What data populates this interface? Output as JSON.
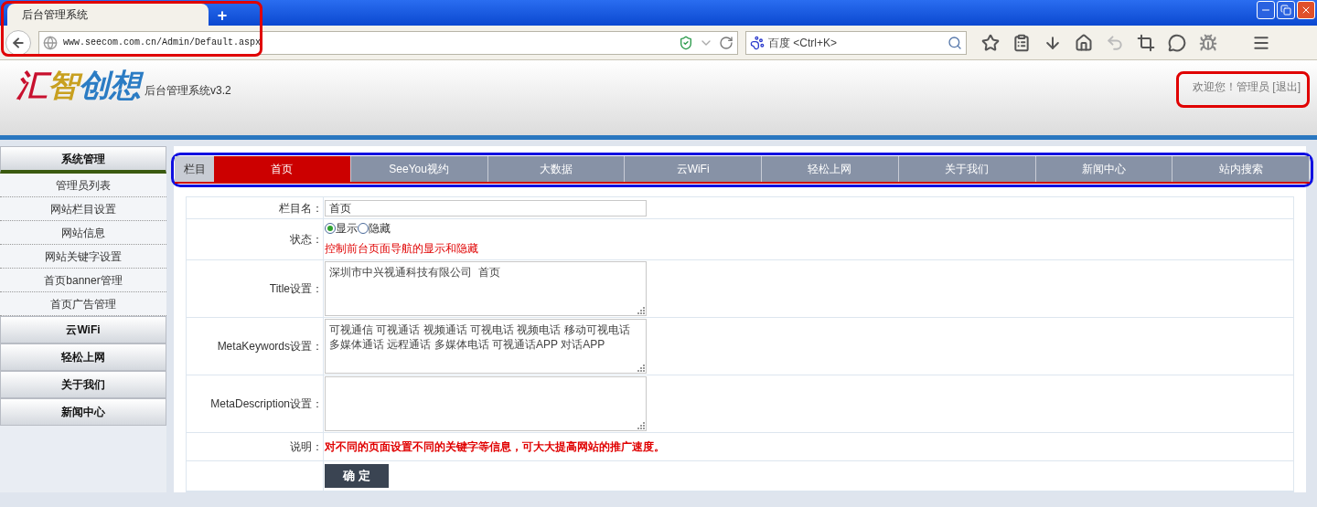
{
  "browser": {
    "tab_title": "后台管理系统",
    "new_tab": "+",
    "url": "www.seecom.com.cn/Admin/Default.aspx",
    "search_placeholder": "百度 <Ctrl+K>"
  },
  "header": {
    "logo": "汇智创想",
    "subtitle": "后台管理系统v3.2",
    "welcome": "欢迎您！管理员",
    "logout": "[退出]"
  },
  "sidebar": {
    "groups": [
      {
        "title": "系统管理",
        "expanded": true,
        "items": [
          "管理员列表",
          "网站栏目设置",
          "网站信息",
          "网站关键字设置",
          "首页banner管理",
          "首页广告管理"
        ]
      },
      {
        "title": "云WiFi",
        "expanded": false
      },
      {
        "title": "轻松上网",
        "expanded": false
      },
      {
        "title": "关于我们",
        "expanded": false
      },
      {
        "title": "新闻中心",
        "expanded": false
      }
    ]
  },
  "nav": {
    "label": "栏目",
    "tabs": [
      {
        "label": "首页",
        "selected": true
      },
      {
        "label": "SeeYou视约",
        "selected": false
      },
      {
        "label": "大数据",
        "selected": false
      },
      {
        "label": "云WiFi",
        "selected": false
      },
      {
        "label": "轻松上网",
        "selected": false
      },
      {
        "label": "关于我们",
        "selected": false
      },
      {
        "label": "新闻中心",
        "selected": false
      },
      {
        "label": "站内搜索",
        "selected": false
      }
    ]
  },
  "form": {
    "rows": [
      {
        "kind": "text",
        "label": "栏目名：",
        "value": "首页"
      },
      {
        "kind": "radio",
        "label": "状态：",
        "options": [
          {
            "label": "显示",
            "selected": true
          },
          {
            "label": "隐藏",
            "selected": false
          }
        ],
        "hint": "控制前台页面导航的显示和隐藏"
      },
      {
        "kind": "textarea",
        "label": "Title设置：",
        "lines": [
          "深圳市中兴视通科技有限公司  首页"
        ]
      },
      {
        "kind": "textarea",
        "label": "MetaKeywords设置：",
        "lines": [
          "可视通信 可视通话 视频通话 可视电话 视频电话 移动可视电话",
          "多媒体通话 远程通话 多媒体电话 可视通话APP 对话APP"
        ]
      },
      {
        "kind": "textarea",
        "label": "MetaDescription设置："
      },
      {
        "kind": "note",
        "label": "说明：",
        "text": "对不同的页面设置不同的关键字等信息，可大大提高网站的推广速度。"
      },
      {
        "kind": "submit",
        "button": "确 定"
      }
    ]
  }
}
